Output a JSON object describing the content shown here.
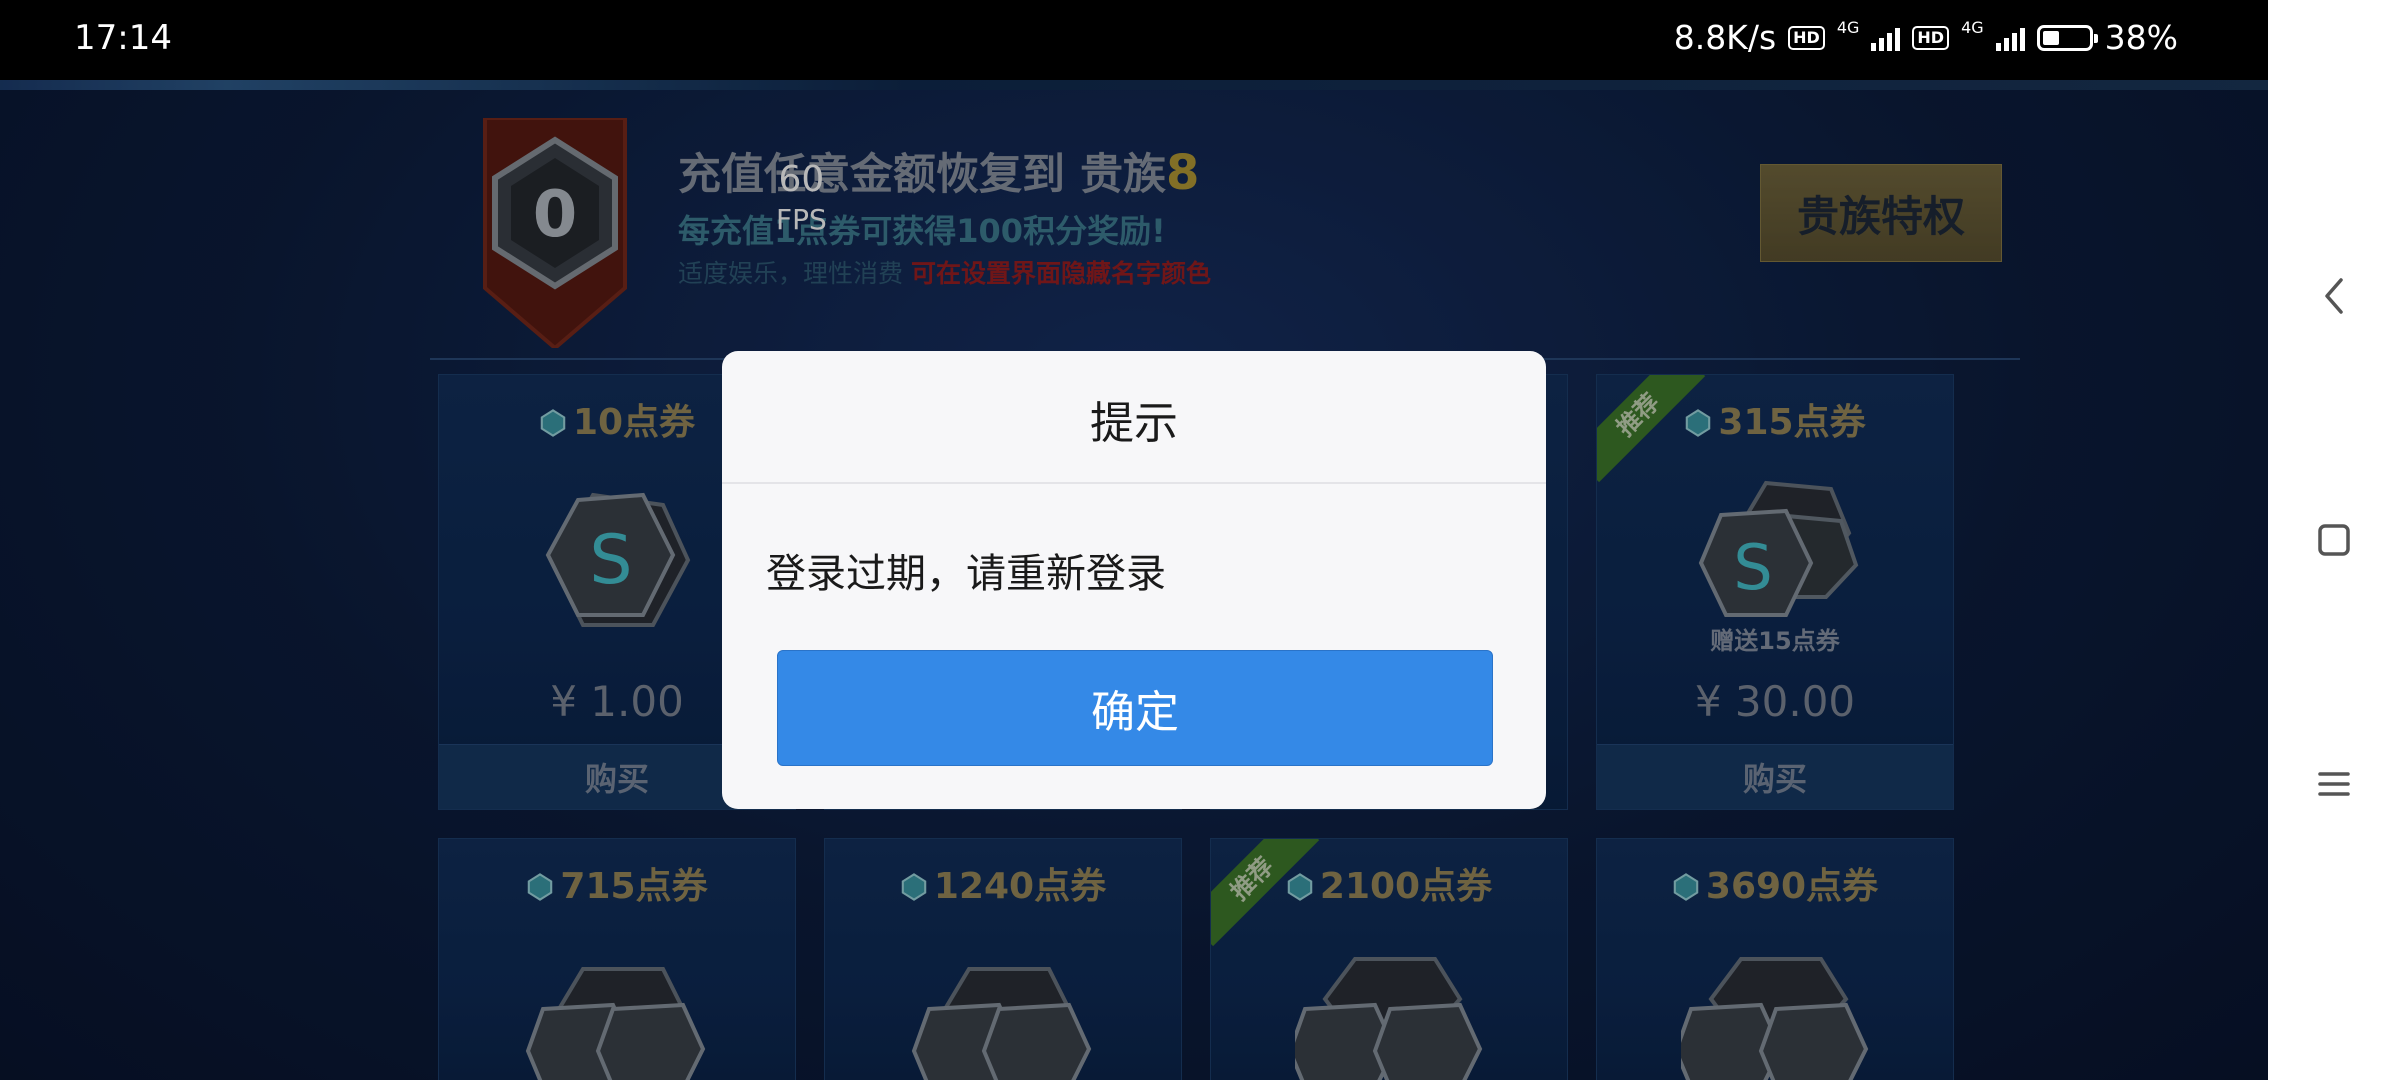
{
  "status_bar": {
    "time": "17:14",
    "net_speed": "8.8K/s",
    "hd_label": "HD",
    "network_type": "4G",
    "battery_percent": "38%",
    "battery_level": 0.38
  },
  "overlay": {
    "fps_value": "60",
    "fps_label": "FPS"
  },
  "header": {
    "title_prefix": "充值任意金额恢复到  贵族",
    "noble_level": "8",
    "subtitle": "每充值1点券可获得100积分奖励!",
    "note_left": "适度娱乐，理性消费 ",
    "note_red": "可在设置界面隐藏名字颜色",
    "noble_button": "贵族特权",
    "badge_digit": "0"
  },
  "cards": [
    {
      "title": "10点券",
      "gift": "",
      "price": "¥ 1.00",
      "buy": "购买",
      "recommended": false
    },
    {
      "title": "315点券",
      "gift": "赠送15点券",
      "price": "¥ 30.00",
      "buy": "购买",
      "recommended": true,
      "ribbon": "推荐"
    },
    {
      "title": "715点券",
      "recommended": false
    },
    {
      "title": "1240点券",
      "recommended": false
    },
    {
      "title": "2100点券",
      "recommended": true,
      "ribbon": "推荐"
    },
    {
      "title": "3690点券",
      "recommended": false
    }
  ],
  "dialog": {
    "title": "提示",
    "message": "登录过期，请重新登录",
    "ok_button": "确定"
  },
  "colors": {
    "accent": "#3489e7",
    "gold": "#b49a35",
    "ribbon_green": "#3f7a2b"
  }
}
